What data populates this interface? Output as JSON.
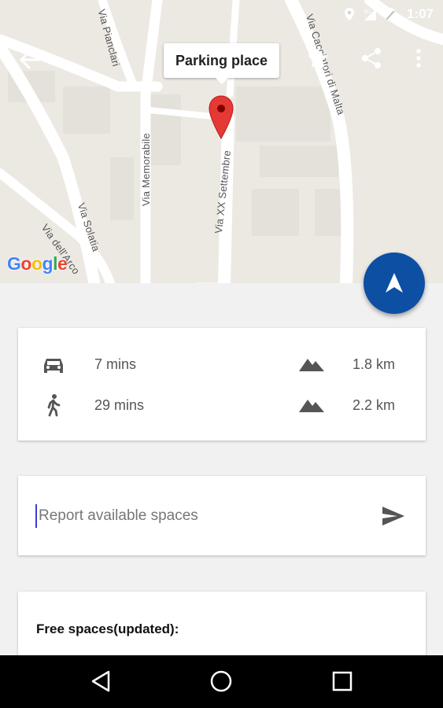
{
  "status_bar": {
    "time": "1:07"
  },
  "map": {
    "streets": [
      "Via Pianclari",
      "Via Cacciatori di Malta",
      "Via Memorabile",
      "Via XX Settembre",
      "Via Solatia",
      "Via dell'Arco"
    ],
    "marker_title": "Parking place",
    "logo_letters": [
      "G",
      "o",
      "o",
      "g",
      "l",
      "e"
    ]
  },
  "travel": {
    "car": {
      "time": "7 mins",
      "distance": "1.8 km",
      "icon": "car-icon"
    },
    "walk": {
      "time": "29 mins",
      "distance": "2.2 km",
      "icon": "walk-icon"
    }
  },
  "report": {
    "placeholder": "Report available spaces"
  },
  "spaces": {
    "title": "Free spaces(updated):"
  },
  "colors": {
    "accent": "#0d4fa3",
    "marker": "#e53935",
    "map_bg": "#ece9e3"
  }
}
